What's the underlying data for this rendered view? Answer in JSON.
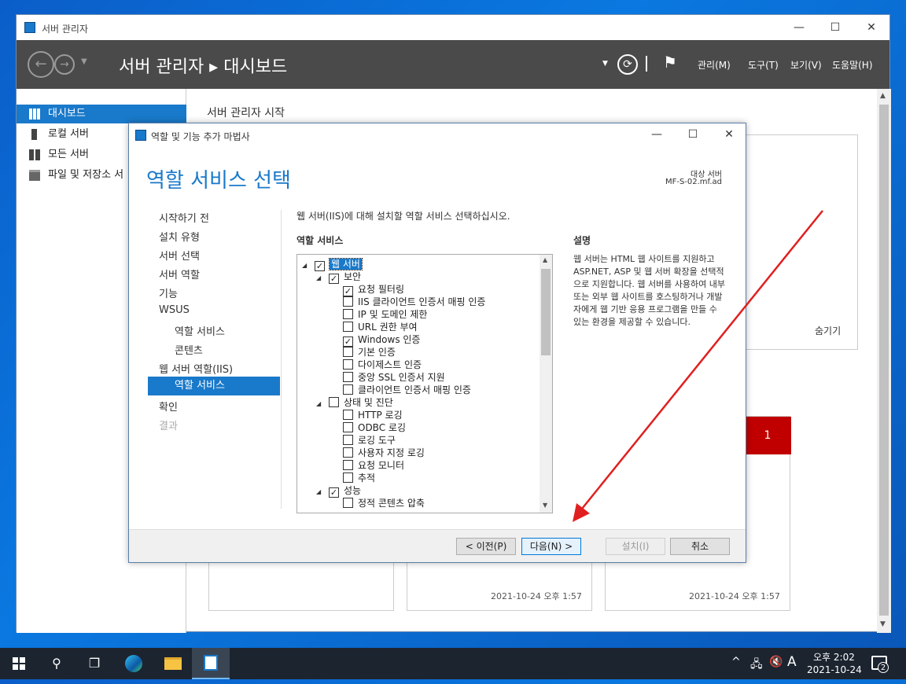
{
  "main_window": {
    "title": "서버 관리자",
    "breadcrumb": "서버 관리자 ▸ 대시보드",
    "menus": [
      "관리(M)",
      "도구(T)",
      "보기(V)",
      "도움말(H)"
    ],
    "sidebar": [
      {
        "label": "대시보드",
        "selected": true
      },
      {
        "label": "로컬 서버",
        "selected": false
      },
      {
        "label": "모든 서버",
        "selected": false
      },
      {
        "label": "파일 및 저장소 서",
        "selected": false
      }
    ],
    "content_title": "서버 관리자 시작",
    "hide_label": "숨기기",
    "badge_count": "1",
    "timestamps": [
      "2021-10-24 오후 1:57",
      "2021-10-24 오후 1:57"
    ]
  },
  "dialog": {
    "title": "역할 및 기능 추가 마법사",
    "heading": "역할 서비스 선택",
    "target_label": "대상 서버",
    "target_value": "MF-S-02.mf.ad",
    "nav": [
      {
        "label": "시작하기 전",
        "level": 0,
        "state": "normal"
      },
      {
        "label": "설치 유형",
        "level": 0,
        "state": "normal"
      },
      {
        "label": "서버 선택",
        "level": 0,
        "state": "normal"
      },
      {
        "label": "서버 역할",
        "level": 0,
        "state": "normal"
      },
      {
        "label": "기능",
        "level": 0,
        "state": "normal"
      },
      {
        "label": "WSUS",
        "level": 0,
        "state": "normal"
      },
      {
        "label": "역할 서비스",
        "level": 1,
        "state": "normal"
      },
      {
        "label": "콘텐츠",
        "level": 1,
        "state": "normal"
      },
      {
        "label": "웹 서버 역할(IIS)",
        "level": 0,
        "state": "normal"
      },
      {
        "label": "역할 서비스",
        "level": 1,
        "state": "selected"
      },
      {
        "label": "확인",
        "level": 0,
        "state": "normal"
      },
      {
        "label": "결과",
        "level": 0,
        "state": "disabled"
      }
    ],
    "instruction": "웹 서버(IIS)에 대해 설치할 역할 서비스 선택하십시오.",
    "role_services_label": "역할 서비스",
    "description_label": "설명",
    "description_text": "웹 서버는 HTML 웹 사이트를 지원하고 ASP.NET, ASP 및 웹 서버 확장을 선택적으로 지원합니다. 웹 서버를 사용하여 내부 또는 외부 웹 사이트를 호스팅하거나 개발자에게 웹 기반 응용 프로그램을 만들 수 있는 환경을 제공할 수 있습니다.",
    "tree": [
      {
        "label": "웹 서버",
        "level": 0,
        "checked": true,
        "expandable": true,
        "highlighted": true
      },
      {
        "label": "보안",
        "level": 1,
        "checked": true,
        "expandable": true
      },
      {
        "label": "요청 필터링",
        "level": 2,
        "checked": true
      },
      {
        "label": "IIS 클라이언트 인증서 매핑 인증",
        "level": 2,
        "checked": false
      },
      {
        "label": "IP 및 도메인 제한",
        "level": 2,
        "checked": false
      },
      {
        "label": "URL 권한 부여",
        "level": 2,
        "checked": false
      },
      {
        "label": "Windows 인증",
        "level": 2,
        "checked": true
      },
      {
        "label": "기본 인증",
        "level": 2,
        "checked": false
      },
      {
        "label": "다이제스트 인증",
        "level": 2,
        "checked": false
      },
      {
        "label": "중앙 SSL 인증서 지원",
        "level": 2,
        "checked": false
      },
      {
        "label": "클라이언트 인증서 매핑 인증",
        "level": 2,
        "checked": false
      },
      {
        "label": "상태 및 진단",
        "level": 1,
        "checked": false,
        "expandable": true
      },
      {
        "label": "HTTP 로깅",
        "level": 2,
        "checked": false
      },
      {
        "label": "ODBC 로깅",
        "level": 2,
        "checked": false
      },
      {
        "label": "로깅 도구",
        "level": 2,
        "checked": false
      },
      {
        "label": "사용자 지정 로깅",
        "level": 2,
        "checked": false
      },
      {
        "label": "요청 모니터",
        "level": 2,
        "checked": false
      },
      {
        "label": "추적",
        "level": 2,
        "checked": false
      },
      {
        "label": "성능",
        "level": 1,
        "checked": true,
        "expandable": true
      },
      {
        "label": "정적 콘텐츠 압축",
        "level": 2,
        "checked": false
      }
    ],
    "buttons": {
      "prev": "< 이전(P)",
      "next": "다음(N) >",
      "install": "설치(I)",
      "cancel": "취소"
    }
  },
  "taskbar": {
    "time": "오후 2:02",
    "date": "2021-10-24",
    "ime": "A",
    "notification_count": "2"
  },
  "colors": {
    "accent": "#1979ca",
    "badge_red": "#c00000",
    "arrow_red": "#e02020"
  }
}
